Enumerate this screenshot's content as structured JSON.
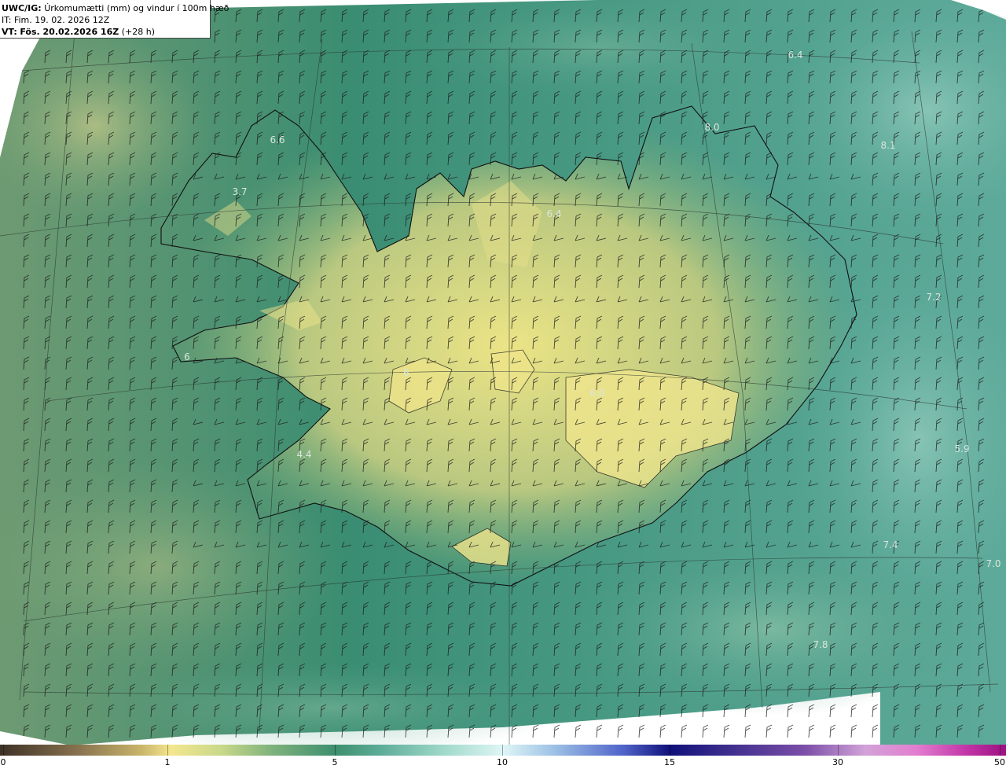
{
  "header": {
    "model": "UWC/IG:",
    "title": "Úrkomumætti (mm) og vindur í 100m hæð",
    "issue_label": "IT:",
    "issue_time": "Fim. 19. 02. 2026 12Z",
    "valid_label": "VT:",
    "valid_time": "Fös. 20.02.2026 16Z",
    "lead_time": "(+28 h)"
  },
  "colorbar": {
    "ticks": [
      "0",
      "1",
      "5",
      "10",
      "15",
      "30",
      "50"
    ]
  },
  "value_labels": [
    "6.6",
    "3.7",
    "6.4",
    "8.0",
    "8.1",
    "6.4",
    "7.2",
    "6",
    "6",
    "6.0",
    "4.4",
    "5.9",
    "7.4",
    "7.0",
    "7.8"
  ],
  "colors": {
    "sea_deep": "#2f8a74",
    "sea_teal": "#5aa898",
    "land_yellow": "#e8df86",
    "land_green": "#9dba7e",
    "coast": "#0d0d0d"
  }
}
